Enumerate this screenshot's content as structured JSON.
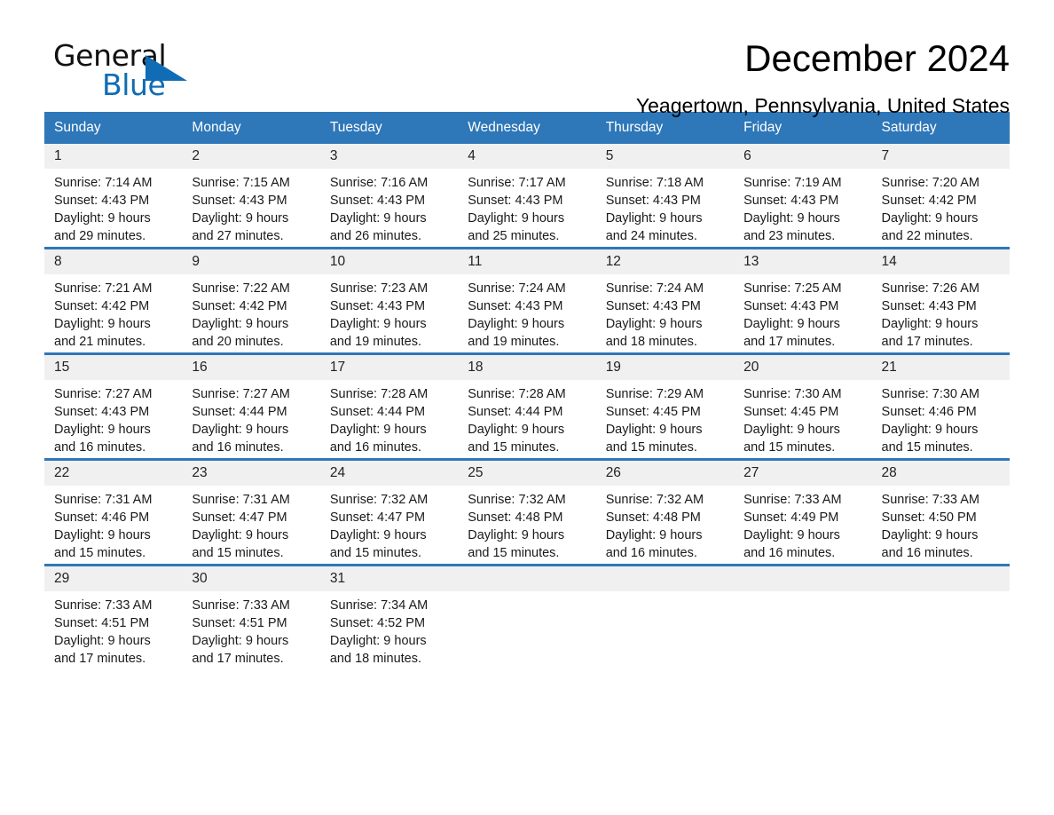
{
  "brand": {
    "logo_top": "General",
    "logo_bottom": "Blue",
    "accent_color": "#0f6cb5"
  },
  "header": {
    "title": "December 2024",
    "location": "Yeagertown, Pennsylvania, United States"
  },
  "theme": {
    "header_blue": "#2e77b8",
    "day_band_gray": "#f0f0f0"
  },
  "weekdays": [
    "Sunday",
    "Monday",
    "Tuesday",
    "Wednesday",
    "Thursday",
    "Friday",
    "Saturday"
  ],
  "weeks": [
    [
      {
        "day": "1",
        "sunrise": "Sunrise: 7:14 AM",
        "sunset": "Sunset: 4:43 PM",
        "daylight_line1": "Daylight: 9 hours",
        "daylight_line2": "and 29 minutes."
      },
      {
        "day": "2",
        "sunrise": "Sunrise: 7:15 AM",
        "sunset": "Sunset: 4:43 PM",
        "daylight_line1": "Daylight: 9 hours",
        "daylight_line2": "and 27 minutes."
      },
      {
        "day": "3",
        "sunrise": "Sunrise: 7:16 AM",
        "sunset": "Sunset: 4:43 PM",
        "daylight_line1": "Daylight: 9 hours",
        "daylight_line2": "and 26 minutes."
      },
      {
        "day": "4",
        "sunrise": "Sunrise: 7:17 AM",
        "sunset": "Sunset: 4:43 PM",
        "daylight_line1": "Daylight: 9 hours",
        "daylight_line2": "and 25 minutes."
      },
      {
        "day": "5",
        "sunrise": "Sunrise: 7:18 AM",
        "sunset": "Sunset: 4:43 PM",
        "daylight_line1": "Daylight: 9 hours",
        "daylight_line2": "and 24 minutes."
      },
      {
        "day": "6",
        "sunrise": "Sunrise: 7:19 AM",
        "sunset": "Sunset: 4:43 PM",
        "daylight_line1": "Daylight: 9 hours",
        "daylight_line2": "and 23 minutes."
      },
      {
        "day": "7",
        "sunrise": "Sunrise: 7:20 AM",
        "sunset": "Sunset: 4:42 PM",
        "daylight_line1": "Daylight: 9 hours",
        "daylight_line2": "and 22 minutes."
      }
    ],
    [
      {
        "day": "8",
        "sunrise": "Sunrise: 7:21 AM",
        "sunset": "Sunset: 4:42 PM",
        "daylight_line1": "Daylight: 9 hours",
        "daylight_line2": "and 21 minutes."
      },
      {
        "day": "9",
        "sunrise": "Sunrise: 7:22 AM",
        "sunset": "Sunset: 4:42 PM",
        "daylight_line1": "Daylight: 9 hours",
        "daylight_line2": "and 20 minutes."
      },
      {
        "day": "10",
        "sunrise": "Sunrise: 7:23 AM",
        "sunset": "Sunset: 4:43 PM",
        "daylight_line1": "Daylight: 9 hours",
        "daylight_line2": "and 19 minutes."
      },
      {
        "day": "11",
        "sunrise": "Sunrise: 7:24 AM",
        "sunset": "Sunset: 4:43 PM",
        "daylight_line1": "Daylight: 9 hours",
        "daylight_line2": "and 19 minutes."
      },
      {
        "day": "12",
        "sunrise": "Sunrise: 7:24 AM",
        "sunset": "Sunset: 4:43 PM",
        "daylight_line1": "Daylight: 9 hours",
        "daylight_line2": "and 18 minutes."
      },
      {
        "day": "13",
        "sunrise": "Sunrise: 7:25 AM",
        "sunset": "Sunset: 4:43 PM",
        "daylight_line1": "Daylight: 9 hours",
        "daylight_line2": "and 17 minutes."
      },
      {
        "day": "14",
        "sunrise": "Sunrise: 7:26 AM",
        "sunset": "Sunset: 4:43 PM",
        "daylight_line1": "Daylight: 9 hours",
        "daylight_line2": "and 17 minutes."
      }
    ],
    [
      {
        "day": "15",
        "sunrise": "Sunrise: 7:27 AM",
        "sunset": "Sunset: 4:43 PM",
        "daylight_line1": "Daylight: 9 hours",
        "daylight_line2": "and 16 minutes."
      },
      {
        "day": "16",
        "sunrise": "Sunrise: 7:27 AM",
        "sunset": "Sunset: 4:44 PM",
        "daylight_line1": "Daylight: 9 hours",
        "daylight_line2": "and 16 minutes."
      },
      {
        "day": "17",
        "sunrise": "Sunrise: 7:28 AM",
        "sunset": "Sunset: 4:44 PM",
        "daylight_line1": "Daylight: 9 hours",
        "daylight_line2": "and 16 minutes."
      },
      {
        "day": "18",
        "sunrise": "Sunrise: 7:28 AM",
        "sunset": "Sunset: 4:44 PM",
        "daylight_line1": "Daylight: 9 hours",
        "daylight_line2": "and 15 minutes."
      },
      {
        "day": "19",
        "sunrise": "Sunrise: 7:29 AM",
        "sunset": "Sunset: 4:45 PM",
        "daylight_line1": "Daylight: 9 hours",
        "daylight_line2": "and 15 minutes."
      },
      {
        "day": "20",
        "sunrise": "Sunrise: 7:30 AM",
        "sunset": "Sunset: 4:45 PM",
        "daylight_line1": "Daylight: 9 hours",
        "daylight_line2": "and 15 minutes."
      },
      {
        "day": "21",
        "sunrise": "Sunrise: 7:30 AM",
        "sunset": "Sunset: 4:46 PM",
        "daylight_line1": "Daylight: 9 hours",
        "daylight_line2": "and 15 minutes."
      }
    ],
    [
      {
        "day": "22",
        "sunrise": "Sunrise: 7:31 AM",
        "sunset": "Sunset: 4:46 PM",
        "daylight_line1": "Daylight: 9 hours",
        "daylight_line2": "and 15 minutes."
      },
      {
        "day": "23",
        "sunrise": "Sunrise: 7:31 AM",
        "sunset": "Sunset: 4:47 PM",
        "daylight_line1": "Daylight: 9 hours",
        "daylight_line2": "and 15 minutes."
      },
      {
        "day": "24",
        "sunrise": "Sunrise: 7:32 AM",
        "sunset": "Sunset: 4:47 PM",
        "daylight_line1": "Daylight: 9 hours",
        "daylight_line2": "and 15 minutes."
      },
      {
        "day": "25",
        "sunrise": "Sunrise: 7:32 AM",
        "sunset": "Sunset: 4:48 PM",
        "daylight_line1": "Daylight: 9 hours",
        "daylight_line2": "and 15 minutes."
      },
      {
        "day": "26",
        "sunrise": "Sunrise: 7:32 AM",
        "sunset": "Sunset: 4:48 PM",
        "daylight_line1": "Daylight: 9 hours",
        "daylight_line2": "and 16 minutes."
      },
      {
        "day": "27",
        "sunrise": "Sunrise: 7:33 AM",
        "sunset": "Sunset: 4:49 PM",
        "daylight_line1": "Daylight: 9 hours",
        "daylight_line2": "and 16 minutes."
      },
      {
        "day": "28",
        "sunrise": "Sunrise: 7:33 AM",
        "sunset": "Sunset: 4:50 PM",
        "daylight_line1": "Daylight: 9 hours",
        "daylight_line2": "and 16 minutes."
      }
    ],
    [
      {
        "day": "29",
        "sunrise": "Sunrise: 7:33 AM",
        "sunset": "Sunset: 4:51 PM",
        "daylight_line1": "Daylight: 9 hours",
        "daylight_line2": "and 17 minutes."
      },
      {
        "day": "30",
        "sunrise": "Sunrise: 7:33 AM",
        "sunset": "Sunset: 4:51 PM",
        "daylight_line1": "Daylight: 9 hours",
        "daylight_line2": "and 17 minutes."
      },
      {
        "day": "31",
        "sunrise": "Sunrise: 7:34 AM",
        "sunset": "Sunset: 4:52 PM",
        "daylight_line1": "Daylight: 9 hours",
        "daylight_line2": "and 18 minutes."
      },
      {
        "day": "",
        "sunrise": "",
        "sunset": "",
        "daylight_line1": "",
        "daylight_line2": ""
      },
      {
        "day": "",
        "sunrise": "",
        "sunset": "",
        "daylight_line1": "",
        "daylight_line2": ""
      },
      {
        "day": "",
        "sunrise": "",
        "sunset": "",
        "daylight_line1": "",
        "daylight_line2": ""
      },
      {
        "day": "",
        "sunrise": "",
        "sunset": "",
        "daylight_line1": "",
        "daylight_line2": ""
      }
    ]
  ]
}
